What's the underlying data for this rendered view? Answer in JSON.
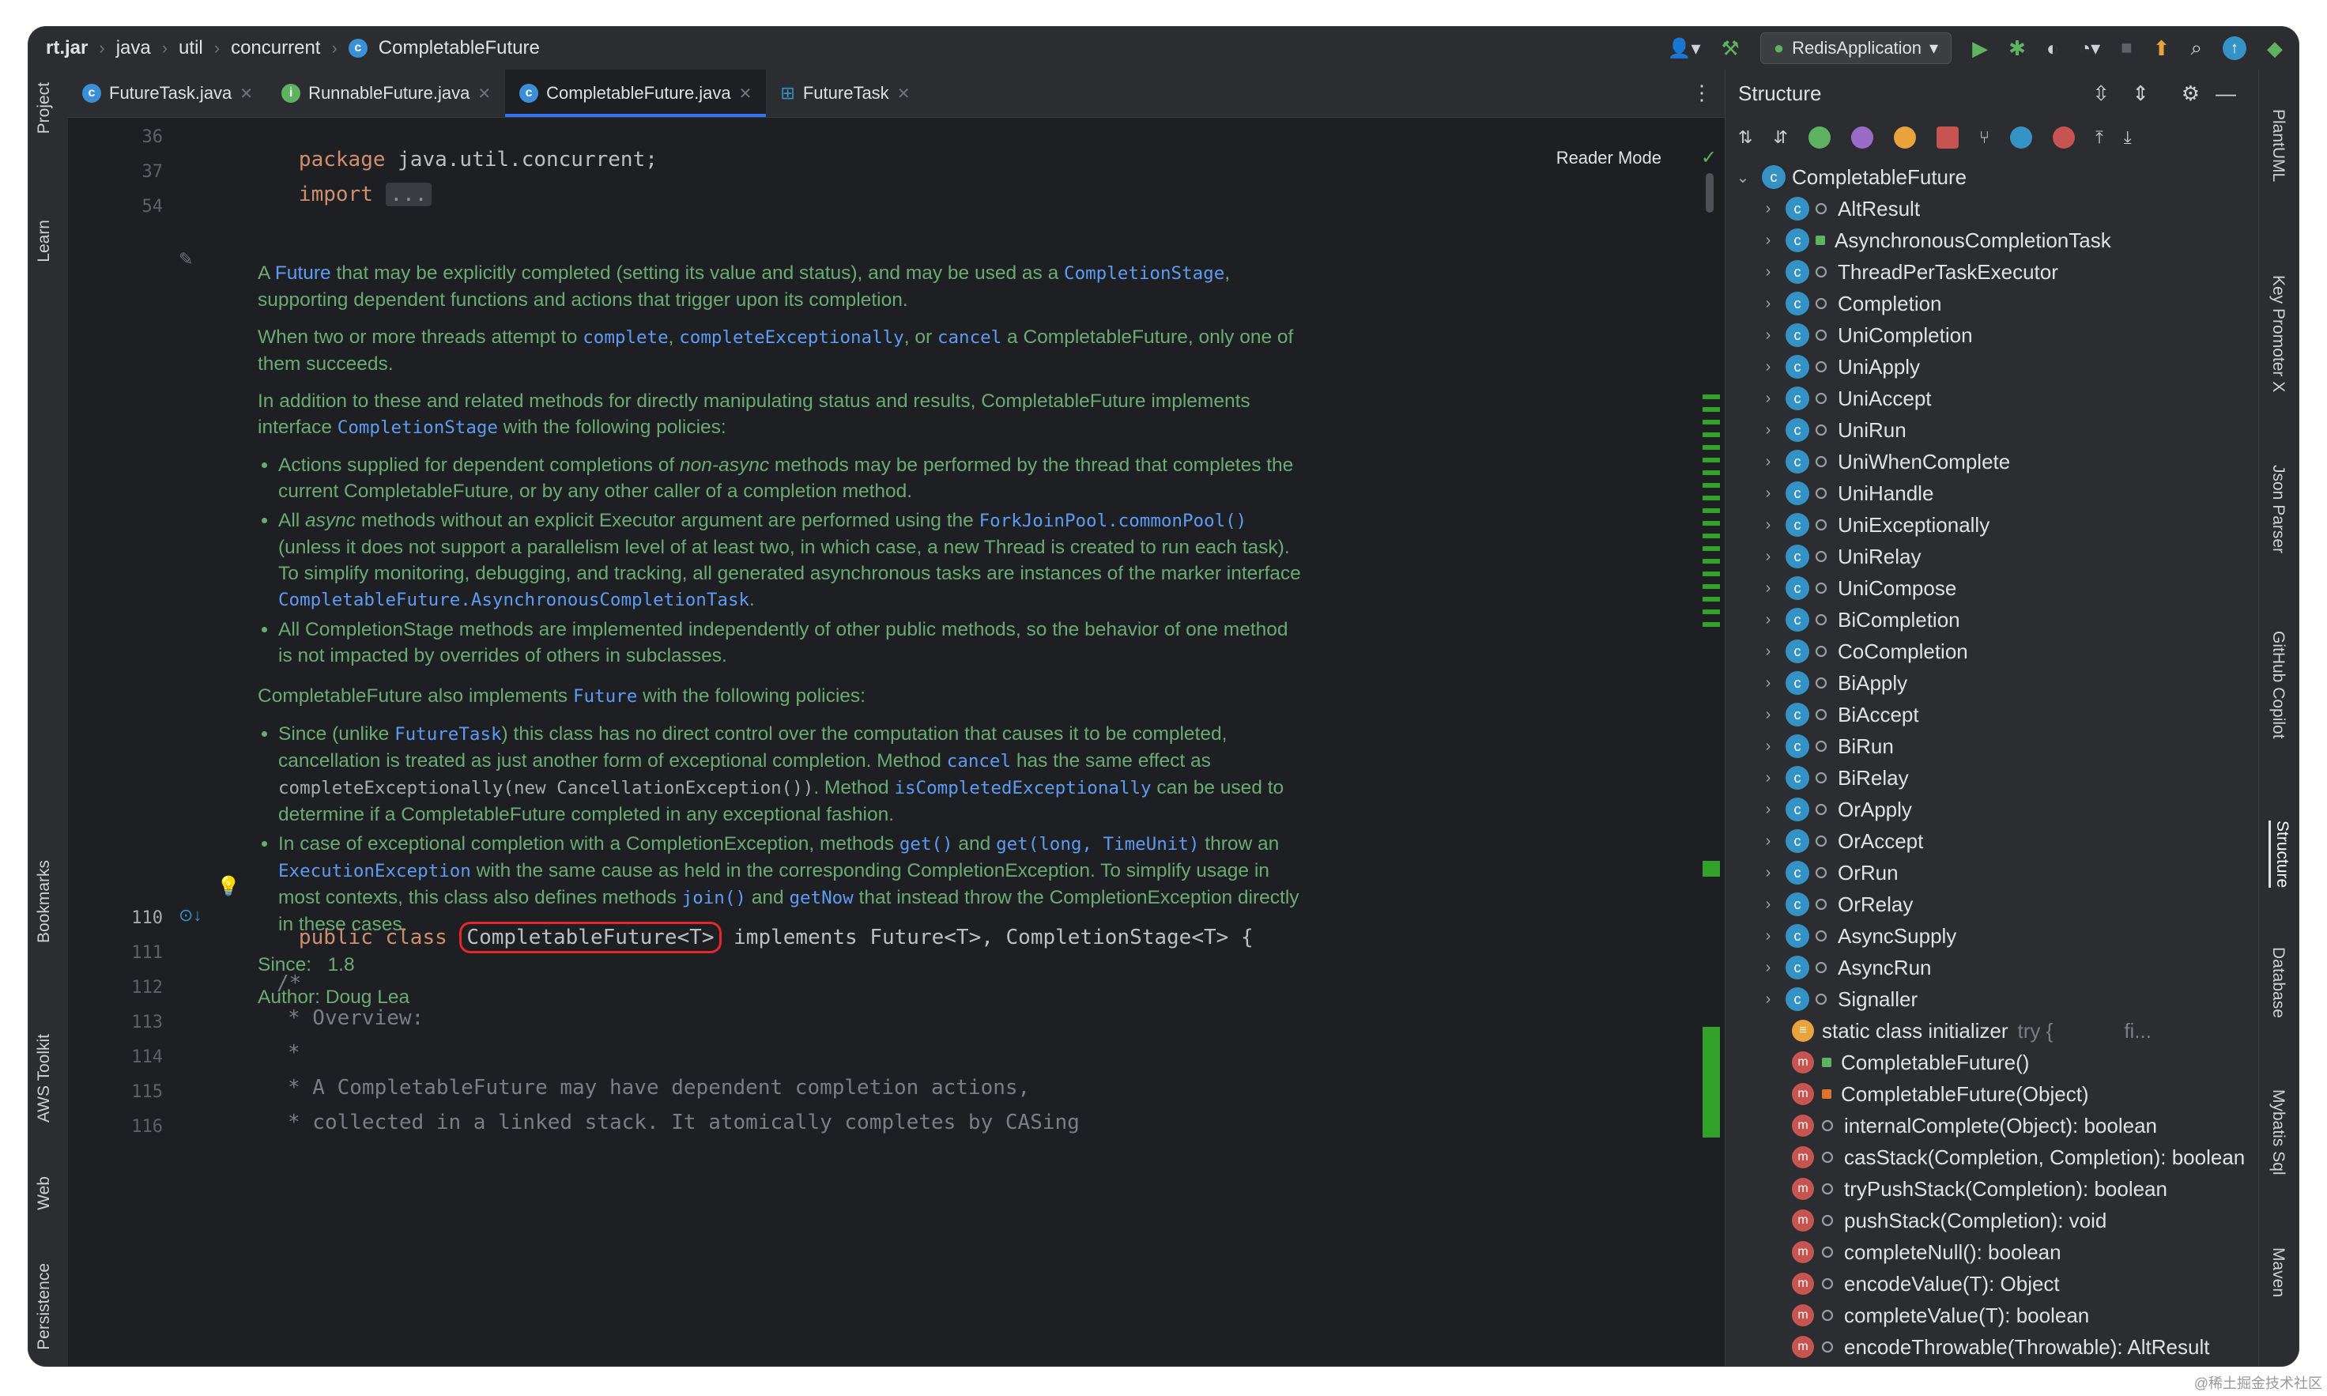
{
  "breadcrumb": [
    "rt.jar",
    "java",
    "util",
    "concurrent",
    "CompletableFuture"
  ],
  "run_config": "RedisApplication",
  "tabs": [
    {
      "label": "FutureTask.java"
    },
    {
      "label": "RunnableFuture.java"
    },
    {
      "label": "CompletableFuture.java"
    },
    {
      "label": "FutureTask"
    }
  ],
  "left_tools": [
    "Project",
    "Learn",
    "Bookmarks",
    "AWS Toolkit",
    "Web",
    "Persistence"
  ],
  "right_tools": [
    "PlantUML",
    "Key Promoter X",
    "Json Parser",
    "GitHub Copilot",
    "Structure",
    "Database",
    "Mybatis Sql",
    "Maven"
  ],
  "editor": {
    "reader_mode": "Reader Mode",
    "line_numbers": [
      "36",
      "37",
      "54",
      "110",
      "111",
      "112",
      "113",
      "114",
      "115",
      "116"
    ],
    "line_package": [
      "package",
      "java.util.concurrent;"
    ],
    "line_import": [
      "import",
      "..."
    ],
    "class_decl": [
      "public class",
      "CompletableFuture<T>",
      "implements Future<T>, CompletionStage<T> {"
    ],
    "comments": [
      "/*",
      "* Overview:",
      "*",
      "* A CompletableFuture may have dependent completion actions,",
      "* collected in a linked stack. It atomically completes by CASing"
    ],
    "doc": {
      "p1": [
        "A",
        "Future",
        "that may be explicitly completed (setting its value and status), and may be used as a",
        "CompletionStage",
        ", supporting dependent functions and actions that trigger upon its completion."
      ],
      "p2": [
        "When two or more threads attempt to",
        "complete",
        ",",
        "completeExceptionally",
        ", or",
        "cancel",
        "a CompletableFuture, only one of them succeeds."
      ],
      "p3": [
        "In addition to these and related methods for directly manipulating status and results, CompletableFuture implements interface",
        "CompletionStage",
        "with the following policies:"
      ],
      "b1": [
        "Actions supplied for dependent completions of",
        "non-async",
        "methods may be performed by the thread that completes the current CompletableFuture, or by any other caller of a completion method."
      ],
      "b2": [
        "All",
        "async",
        "methods without an explicit Executor argument are performed using the",
        "ForkJoinPool.commonPool()",
        "(unless it does not support a parallelism level of at least two, in which case, a new Thread is created to run each task). To simplify monitoring, debugging, and tracking, all generated asynchronous tasks are instances of the marker interface",
        "CompletableFuture.AsynchronousCompletionTask",
        "."
      ],
      "b3": "All CompletionStage methods are implemented independently of other public methods, so the behavior of one method is not impacted by overrides of others in subclasses.",
      "p4": [
        "CompletableFuture also implements",
        "Future",
        "with the following policies:"
      ],
      "b4": [
        "Since (unlike",
        "FutureTask",
        ") this class has no direct control over the computation that causes it to be completed, cancellation is treated as just another form of exceptional completion. Method",
        "cancel",
        "has the same effect as",
        "completeExceptionally(new CancellationException())",
        ". Method",
        "isCompletedExceptionally",
        "can be used to determine if a CompletableFuture completed in any exceptional fashion."
      ],
      "b5": [
        "In case of exceptional completion with a CompletionException, methods",
        "get()",
        "and",
        "get(long, TimeUnit)",
        "throw an",
        "ExecutionException",
        "with the same cause as held in the corresponding CompletionException. To simplify usage in most contexts, this class also defines methods",
        "join()",
        "and",
        "getNow",
        "that instead throw the CompletionException directly in these cases."
      ],
      "since": [
        "Since:",
        "1.8"
      ],
      "author": [
        "Author:",
        "Doug Lea"
      ]
    }
  },
  "structure": {
    "title": "Structure",
    "root": "CompletableFuture",
    "nested": [
      "AltResult",
      "AsynchronousCompletionTask",
      "ThreadPerTaskExecutor",
      "Completion",
      "UniCompletion",
      "UniApply",
      "UniAccept",
      "UniRun",
      "UniWhenComplete",
      "UniHandle",
      "UniExceptionally",
      "UniRelay",
      "UniCompose",
      "BiCompletion",
      "CoCompletion",
      "BiApply",
      "BiAccept",
      "BiRun",
      "BiRelay",
      "OrApply",
      "OrAccept",
      "OrRun",
      "OrRelay",
      "AsyncSupply",
      "AsyncRun",
      "Signaller"
    ],
    "static_init": [
      "static class initializer",
      "try {",
      "fi..."
    ],
    "members": [
      "CompletableFuture()",
      "CompletableFuture(Object)",
      "internalComplete(Object): boolean",
      "casStack(Completion, Completion): boolean",
      "tryPushStack(Completion): boolean",
      "pushStack(Completion): void",
      "completeNull(): boolean",
      "encodeValue(T): Object",
      "completeValue(T): boolean",
      "encodeThrowable(Throwable): AltResult"
    ]
  },
  "watermark": "@稀土掘金技术社区",
  "colors": {
    "accent": "#3574f0",
    "keyword": "#cf8e6d",
    "doc_text": "#6aab73",
    "highlight_box": "#e5262d"
  }
}
